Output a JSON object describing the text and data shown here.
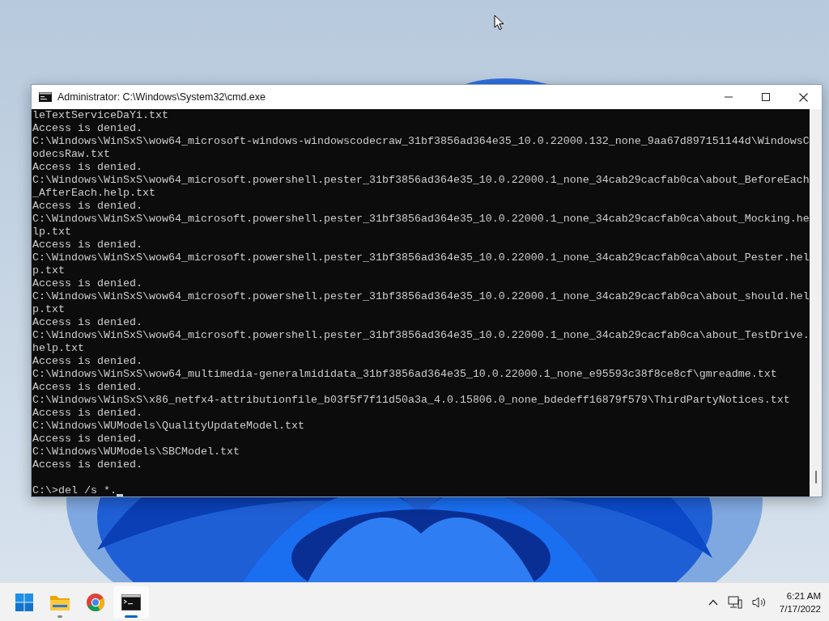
{
  "window": {
    "title": "Administrator: C:\\Windows\\System32\\cmd.exe",
    "lines": [
      "leTextServiceDaYi.txt",
      "Access is denied.",
      "C:\\Windows\\WinSxS\\wow64_microsoft-windows-windowscodecraw_31bf3856ad364e35_10.0.22000.132_none_9aa67d897151144d\\WindowsC",
      "odecsRaw.txt",
      "Access is denied.",
      "C:\\Windows\\WinSxS\\wow64_microsoft.powershell.pester_31bf3856ad364e35_10.0.22000.1_none_34cab29cacfab0ca\\about_BeforeEach",
      "_AfterEach.help.txt",
      "Access is denied.",
      "C:\\Windows\\WinSxS\\wow64_microsoft.powershell.pester_31bf3856ad364e35_10.0.22000.1_none_34cab29cacfab0ca\\about_Mocking.he",
      "lp.txt",
      "Access is denied.",
      "C:\\Windows\\WinSxS\\wow64_microsoft.powershell.pester_31bf3856ad364e35_10.0.22000.1_none_34cab29cacfab0ca\\about_Pester.hel",
      "p.txt",
      "Access is denied.",
      "C:\\Windows\\WinSxS\\wow64_microsoft.powershell.pester_31bf3856ad364e35_10.0.22000.1_none_34cab29cacfab0ca\\about_should.hel",
      "p.txt",
      "Access is denied.",
      "C:\\Windows\\WinSxS\\wow64_microsoft.powershell.pester_31bf3856ad364e35_10.0.22000.1_none_34cab29cacfab0ca\\about_TestDrive.",
      "help.txt",
      "Access is denied.",
      "C:\\Windows\\WinSxS\\wow64_multimedia-generalmididata_31bf3856ad364e35_10.0.22000.1_none_e95593c38f8ce8cf\\gmreadme.txt",
      "Access is denied.",
      "C:\\Windows\\WinSxS\\x86_netfx4-attributionfile_b03f5f7f11d50a3a_4.0.15806.0_none_bdedeff16879f579\\ThirdPartyNotices.txt",
      "Access is denied.",
      "C:\\Windows\\WUModels\\QualityUpdateModel.txt",
      "Access is denied.",
      "C:\\Windows\\WUModels\\SBCModel.txt",
      "Access is denied."
    ],
    "prompt": "C:\\>del /s *."
  },
  "taskbar": {
    "apps": [
      {
        "kind": "start",
        "running": false,
        "selected": false
      },
      {
        "kind": "explorer",
        "running": true,
        "selected": false
      },
      {
        "kind": "browser",
        "running": false,
        "selected": false
      },
      {
        "kind": "terminal",
        "running": true,
        "selected": true
      }
    ],
    "clock": {
      "time": "6:21 AM",
      "date": "7/17/2022"
    }
  }
}
